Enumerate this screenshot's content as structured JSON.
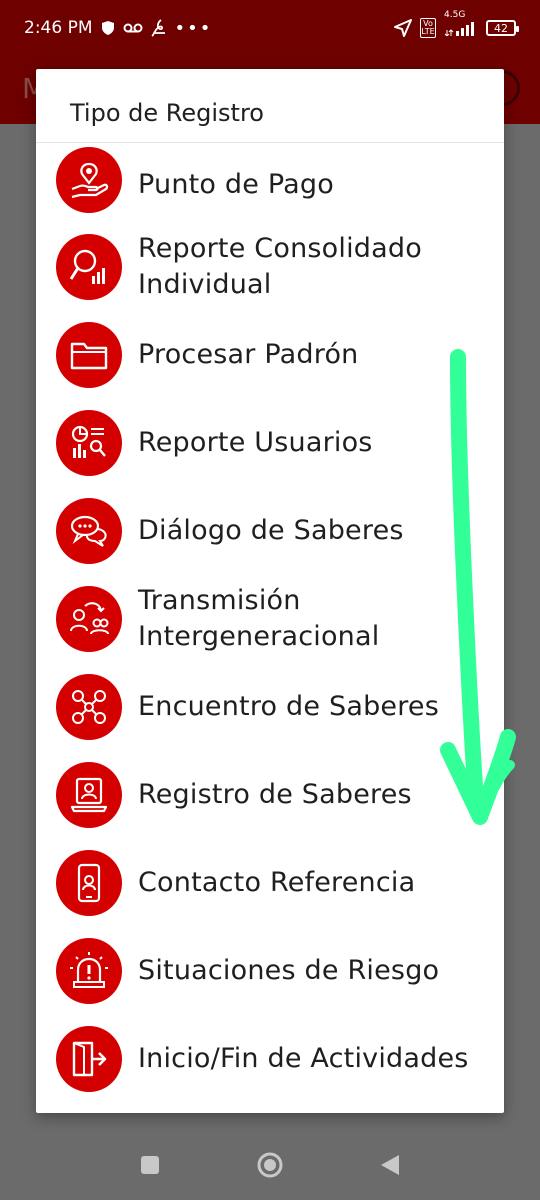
{
  "status_bar": {
    "time": "2:46 PM",
    "network": "4.5G",
    "volte": "Vo LTE",
    "battery": "42"
  },
  "app_bar": {
    "letter": "M"
  },
  "dialog": {
    "title": "Tipo de Registro",
    "items": [
      {
        "label": "Punto de Pago",
        "icon": "payment-point-icon"
      },
      {
        "label": "Reporte Consolidado Individual",
        "icon": "magnifier-chart-icon"
      },
      {
        "label": "Procesar Padrón",
        "icon": "folder-icon"
      },
      {
        "label": "Reporte Usuarios",
        "icon": "users-report-icon"
      },
      {
        "label": "Diálogo de Saberes",
        "icon": "chat-bubbles-icon"
      },
      {
        "label": "Transmisión Intergeneracional",
        "icon": "generations-icon"
      },
      {
        "label": "Encuentro de Saberes",
        "icon": "network-people-icon"
      },
      {
        "label": "Registro de Saberes",
        "icon": "laptop-user-icon"
      },
      {
        "label": "Contacto Referencia",
        "icon": "phone-contact-icon"
      },
      {
        "label": "Situaciones de Riesgo",
        "icon": "alarm-icon"
      },
      {
        "label": "Inicio/Fin de Actividades",
        "icon": "exit-door-icon"
      }
    ]
  },
  "colors": {
    "accent": "#d40000",
    "status_bar": "#6e0000",
    "overlay": "#6b6b6b",
    "annotation_arrow": "#33ff99"
  }
}
